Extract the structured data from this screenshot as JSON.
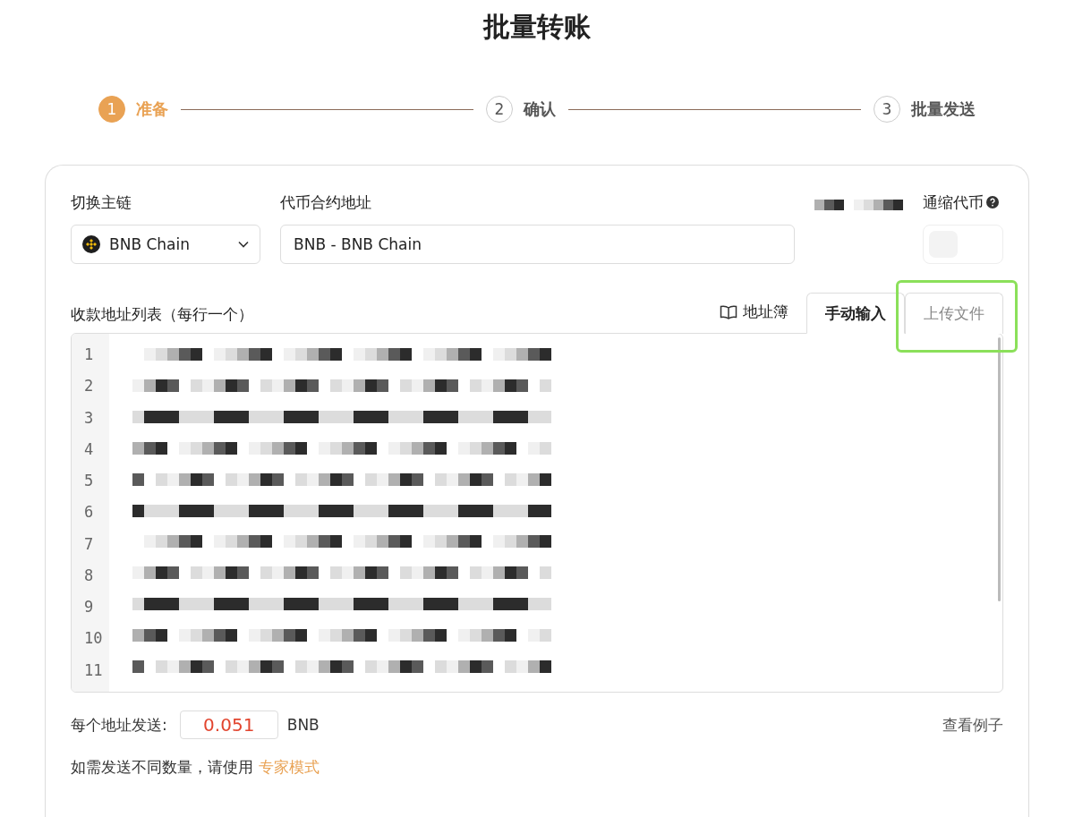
{
  "page_title": "批量转账",
  "steps": [
    {
      "number": "1",
      "label": "准备",
      "selected": true
    },
    {
      "number": "2",
      "label": "确认",
      "selected": false
    },
    {
      "number": "3",
      "label": "批量发送",
      "selected": false
    }
  ],
  "chain": {
    "label": "切换主链",
    "value": "BNB Chain"
  },
  "token": {
    "label": "代币合约地址",
    "value": "BNB - BNB Chain"
  },
  "deflation": {
    "label": "通缩代币",
    "on": false
  },
  "recipients": {
    "label": "收款地址列表（每行一个）",
    "address_book_link": "地址簿",
    "tabs": [
      {
        "label": "手动输入",
        "selected": true,
        "highlighted": false
      },
      {
        "label": "上传文件",
        "selected": false,
        "highlighted": true
      }
    ],
    "line_numbers": [
      "1",
      "2",
      "3",
      "4",
      "5",
      "6",
      "7",
      "8",
      "9",
      "10",
      "11"
    ]
  },
  "amount": {
    "label": "每个地址发送:",
    "value": "0.051",
    "unit": "BNB"
  },
  "example_link": "查看例子",
  "note": {
    "text": "如需发送不同数量，请使用",
    "link": "专家模式"
  }
}
